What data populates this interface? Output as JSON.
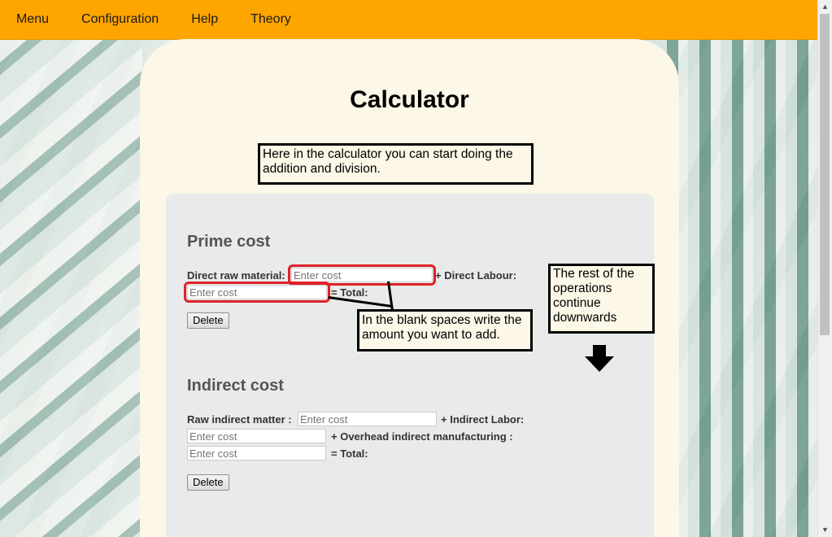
{
  "nav": {
    "items": [
      {
        "label": "Menu"
      },
      {
        "label": "Configuration"
      },
      {
        "label": "Help"
      },
      {
        "label": "Theory"
      }
    ]
  },
  "page": {
    "title": "Calculator",
    "intro_note": "Here in the calculator you can start doing the addition and division."
  },
  "prime": {
    "title": "Prime cost",
    "raw_material_label": "Direct raw material:",
    "labour_label": "+ Direct Labour:",
    "total_label": "= Total:",
    "placeholder": "Enter cost",
    "delete_label": "Delete",
    "blank_note": "In the blank spaces write the amount you want to add.",
    "rest_note": "The rest of the operations continue downwards"
  },
  "indirect": {
    "title": "Indirect cost",
    "raw_label": "Raw indirect matter :",
    "labor_label": "+ Indirect Labor:",
    "overhead_label": "+ Overhead indirect manufacturing :",
    "total_label": "= Total:",
    "placeholder": "Enter cost",
    "delete_label": "Delete"
  },
  "colors": {
    "nav_bg": "#ffa500",
    "card_bg": "#fcf7e6",
    "panel_bg": "#e8ebea",
    "highlight": "#e0202a"
  }
}
